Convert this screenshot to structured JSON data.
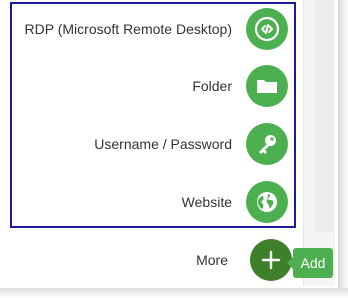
{
  "menu": {
    "items": [
      {
        "label": "RDP (Microsoft Remote Desktop)",
        "icon": "rdp-icon"
      },
      {
        "label": "Folder",
        "icon": "folder-icon"
      },
      {
        "label": "Username / Password",
        "icon": "key-icon"
      },
      {
        "label": "Website",
        "icon": "globe-icon"
      }
    ],
    "more": {
      "label": "More",
      "icon": "plus-icon"
    }
  },
  "tooltip": {
    "label": "Add"
  },
  "colors": {
    "accent": "#4caf50",
    "accent_dark": "#3e7f2a",
    "highlight_border": "#1a1aa0",
    "text": "#333333"
  }
}
